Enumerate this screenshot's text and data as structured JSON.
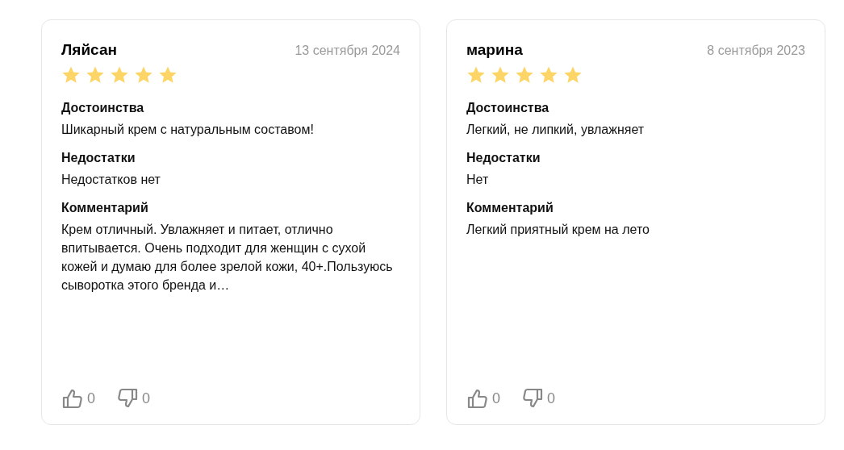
{
  "reviews": [
    {
      "author": "Ляйсан",
      "date": "13 сентября 2024",
      "stars": 5,
      "sections": [
        {
          "heading": "Достоинства",
          "text": "Шикарный крем с натуральным составом!"
        },
        {
          "heading": "Недостатки",
          "text": "Недостатков нет"
        },
        {
          "heading": "Комментарий",
          "text": "Крем отличный. Увлажняет и питает, отлично впитывается. Очень подходит для женщин с сухой кожей и думаю для более зрелой кожи, 40+.Пользуюсь сыворотка этого бренда и…"
        }
      ],
      "likes": "0",
      "dislikes": "0"
    },
    {
      "author": "марина",
      "date": "8 сентября 2023",
      "stars": 5,
      "sections": [
        {
          "heading": "Достоинства",
          "text": "Легкий, не липкий, увлажняет"
        },
        {
          "heading": "Недостатки",
          "text": "Нет"
        },
        {
          "heading": "Комментарий",
          "text": "Легкий приятный крем на лето"
        }
      ],
      "likes": "0",
      "dislikes": "0"
    }
  ]
}
